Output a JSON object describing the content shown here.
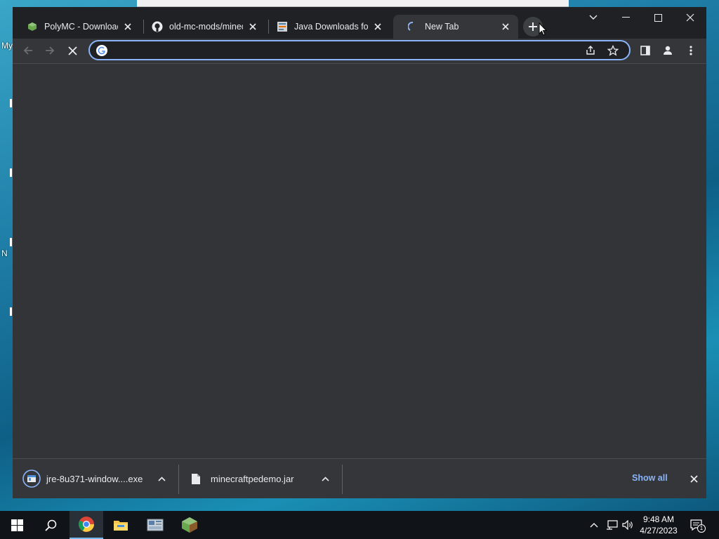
{
  "desktop": {
    "labels": [
      "My",
      "N"
    ]
  },
  "browser": {
    "tabs": [
      {
        "title": "PolyMC - Download f",
        "favicon": "polymc-icon"
      },
      {
        "title": "old-mc-mods/minecr",
        "favicon": "github-icon"
      },
      {
        "title": "Java Downloads for A",
        "favicon": "java-icon"
      },
      {
        "title": "New Tab",
        "favicon": "loading-spinner-icon",
        "active": true
      }
    ],
    "omnibox": {
      "value": "",
      "placeholder": ""
    },
    "downloads": [
      {
        "name": "jre-8u371-window....exe",
        "icon": "installer-icon"
      },
      {
        "name": "minecraftpedemo.jar",
        "icon": "file-icon"
      }
    ],
    "show_all_label": "Show all"
  },
  "taskbar": {
    "apps": [
      "windows-start-icon",
      "search-icon",
      "chrome-icon",
      "file-explorer-icon",
      "app-icon",
      "polymc-icon"
    ],
    "clock": {
      "time": "9:48 AM",
      "date": "4/27/2023"
    },
    "notification_count": "1"
  },
  "colors": {
    "accent": "#8ab4f8",
    "tab_bg": "#202124",
    "toolbar_bg": "#35363a",
    "content_bg": "#333437"
  }
}
